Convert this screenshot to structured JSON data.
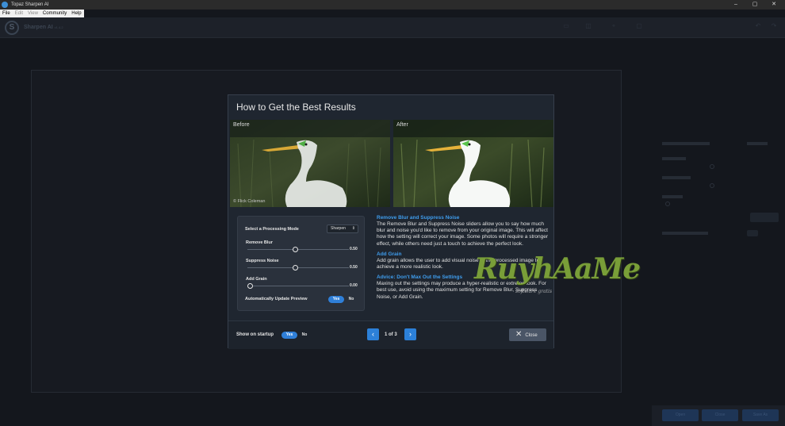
{
  "window": {
    "title": "Topaz Sharpen AI",
    "controls": [
      "–",
      "▢",
      "✕"
    ]
  },
  "menu": [
    {
      "label": "File",
      "enabled": true
    },
    {
      "label": "Edit",
      "enabled": false
    },
    {
      "label": "View",
      "enabled": false
    },
    {
      "label": "Community",
      "enabled": true
    },
    {
      "label": "Help",
      "enabled": true
    }
  ],
  "app": {
    "name": "Sharpen AI",
    "version": "v1.4.2",
    "logo_letter": "S"
  },
  "bottom_buttons": {
    "open": "Open",
    "close": "Close",
    "save_as": "Save As"
  },
  "dialog": {
    "title": "How to Get the Best Results",
    "before_label": "Before",
    "after_label": "After",
    "copyright": "© Flick Coleman",
    "settings": {
      "mode_label": "Select a Processing Mode",
      "mode_value": "Sharpen",
      "remove_blur": {
        "label": "Remove Blur",
        "value": "0.50"
      },
      "suppress_noise": {
        "label": "Suppress Noise",
        "value": "0.50"
      },
      "add_grain": {
        "label": "Add Grain",
        "value": "0.00"
      },
      "auto_update": {
        "label": "Automatically Update Preview",
        "yes": "Yes",
        "no": "No"
      }
    },
    "help": [
      {
        "heading": "Remove Blur and Suppress Noise",
        "body": "The Remove Blur and Suppress Noise sliders allow you to say how much blur and noise you'd like to remove from your original image. This will affect how the setting will correct your image. Some photos will require a stronger effect, while others need just a touch to achieve the perfect look."
      },
      {
        "heading": "Add Grain",
        "body": "Add grain allows the user to add visual noise to the processed image to achieve a more realistic look."
      },
      {
        "heading": "Advice: Don't Max Out the Settings",
        "body": "Maxing out the settings may produce a hyper-realistic or extreme look. For best use, avoid using the maximum setting for Remove Blur, Suppress Noise, or Add Grain."
      }
    ],
    "footer": {
      "startup_label": "Show on startup",
      "yes": "Yes",
      "no": "No",
      "page": "1 of 3",
      "prev": "‹",
      "next": "›",
      "close": "Close"
    }
  },
  "watermark": {
    "text": "RuyhAaMe",
    "sub": "software gratis"
  },
  "colors": {
    "accent": "#2f7fd8",
    "heading_blue": "#3f9ded",
    "dialog_bg": "#1f2630"
  }
}
